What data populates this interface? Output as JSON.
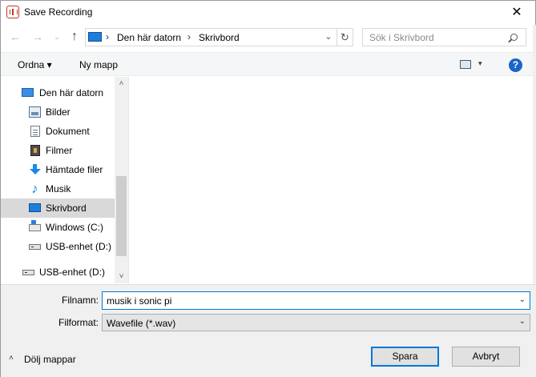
{
  "window": {
    "title": "Save Recording",
    "close_glyph": "✕"
  },
  "navigation": {
    "back_glyph": "←",
    "forward_glyph": "→",
    "recent_glyph": "⌄",
    "up_glyph": "↑",
    "breadcrumbs": [
      "Den här datorn",
      "Skrivbord"
    ],
    "sep_glyph": "›",
    "dropdown_glyph": "⌄",
    "refresh_glyph": "↻"
  },
  "search": {
    "placeholder": "Sök i Skrivbord"
  },
  "toolbar": {
    "organize_label": "Ordna ▾",
    "new_folder_label": "Ny mapp",
    "view_drop_glyph": "▾",
    "help_glyph": "?"
  },
  "tree": {
    "items": [
      {
        "label": "Den här datorn",
        "icon": "computer-icon"
      },
      {
        "label": "Bilder",
        "icon": "pictures-icon"
      },
      {
        "label": "Dokument",
        "icon": "documents-icon"
      },
      {
        "label": "Filmer",
        "icon": "videos-icon"
      },
      {
        "label": "Hämtade filer",
        "icon": "downloads-icon"
      },
      {
        "label": "Musik",
        "icon": "music-icon"
      },
      {
        "label": "Skrivbord",
        "icon": "desktop-icon",
        "selected": true
      },
      {
        "label": "Windows (C:)",
        "icon": "system-drive-icon"
      },
      {
        "label": "USB-enhet (D:)",
        "icon": "usb-drive-icon"
      },
      {
        "label": "USB-enhet (D:)",
        "icon": "usb-drive-icon"
      }
    ],
    "scroll_up_glyph": "˄",
    "scroll_down_glyph": "˅"
  },
  "form": {
    "filename_label": "Filnamn:",
    "filename_value": "musik i sonic pi",
    "filetype_label": "Filformat:",
    "filetype_value": "Wavefile (*.wav)",
    "drop_glyph": "⌄"
  },
  "footer": {
    "hide_folders_label": "Dölj mappar",
    "chevron_glyph": "˄",
    "save_label": "Spara",
    "cancel_label": "Avbryt"
  }
}
